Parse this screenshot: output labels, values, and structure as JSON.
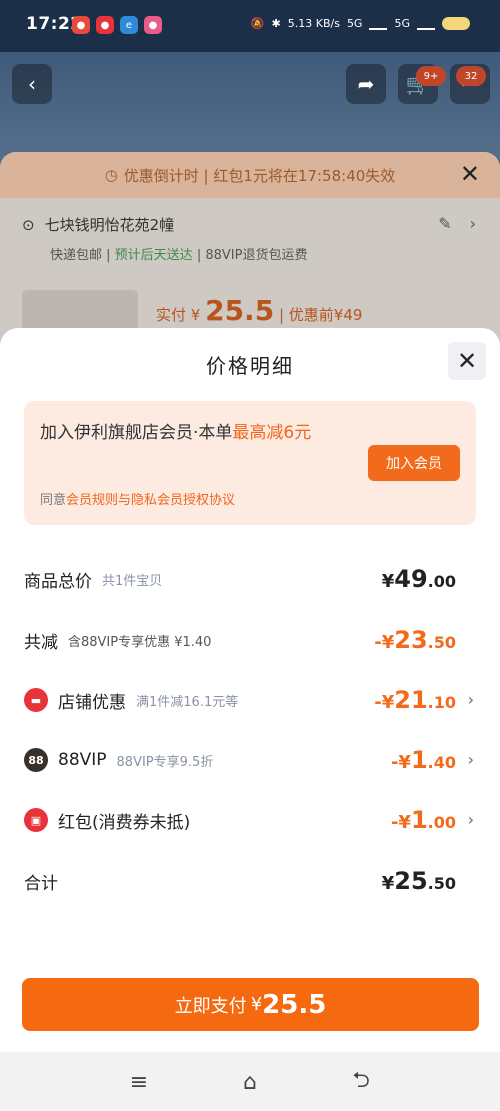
{
  "status_bar": {
    "time": "17:22",
    "net_speed": "5.13 KB/s",
    "net1": "5G",
    "net2": "5G"
  },
  "background": {
    "cart_badge_1": "9+",
    "cart_badge_2": "32",
    "countdown_text": "优惠倒计时 | 红包1元将在17:58:40失效",
    "address": "七块钱明怡花苑2幢",
    "shipping_free": "快递包邮",
    "shipping_eta": "预计后天送达",
    "shipping_vip": "88VIP退货包运费",
    "paid_prefix": "实付 ¥",
    "paid_amount": "25.5",
    "paid_before": "| 优惠前¥49"
  },
  "sheet": {
    "title": "价格明细",
    "member": {
      "text_prefix": "加入伊利旗舰店会员·本单",
      "text_highlight": "最高减6元",
      "join_button": "加入会员",
      "agree_prefix": "同意",
      "agree_link": "会员规则与隐私会员授权协议"
    },
    "rows": [
      {
        "label": "商品总价",
        "sub": "共1件宝贝",
        "currency": "¥",
        "int": "49",
        "dec": ".00",
        "negative": false
      },
      {
        "label": "共减",
        "sub": "含88VIP专享优惠 ¥1.40",
        "currency": "-¥",
        "int": "23",
        "dec": ".50",
        "negative": true
      },
      {
        "label": "店铺优惠",
        "sub": "满1件减16.1元等",
        "currency": "-¥",
        "int": "21",
        "dec": ".10",
        "negative": true
      },
      {
        "label": "88VIP",
        "sub": "88VIP专享9.5折",
        "currency": "-¥",
        "int": "1",
        "dec": ".40",
        "negative": true
      },
      {
        "label": "红包(消费券未抵)",
        "sub": "",
        "currency": "-¥",
        "int": "1",
        "dec": ".00",
        "negative": true
      },
      {
        "label": "合计",
        "sub": "",
        "currency": "¥",
        "int": "25",
        "dec": ".50",
        "negative": false
      }
    ],
    "pay_button": {
      "label": "立即支付",
      "currency": "¥",
      "amount": "25.5"
    }
  },
  "colors": {
    "accent": "#f56a10",
    "highlight": "#f1661d"
  }
}
